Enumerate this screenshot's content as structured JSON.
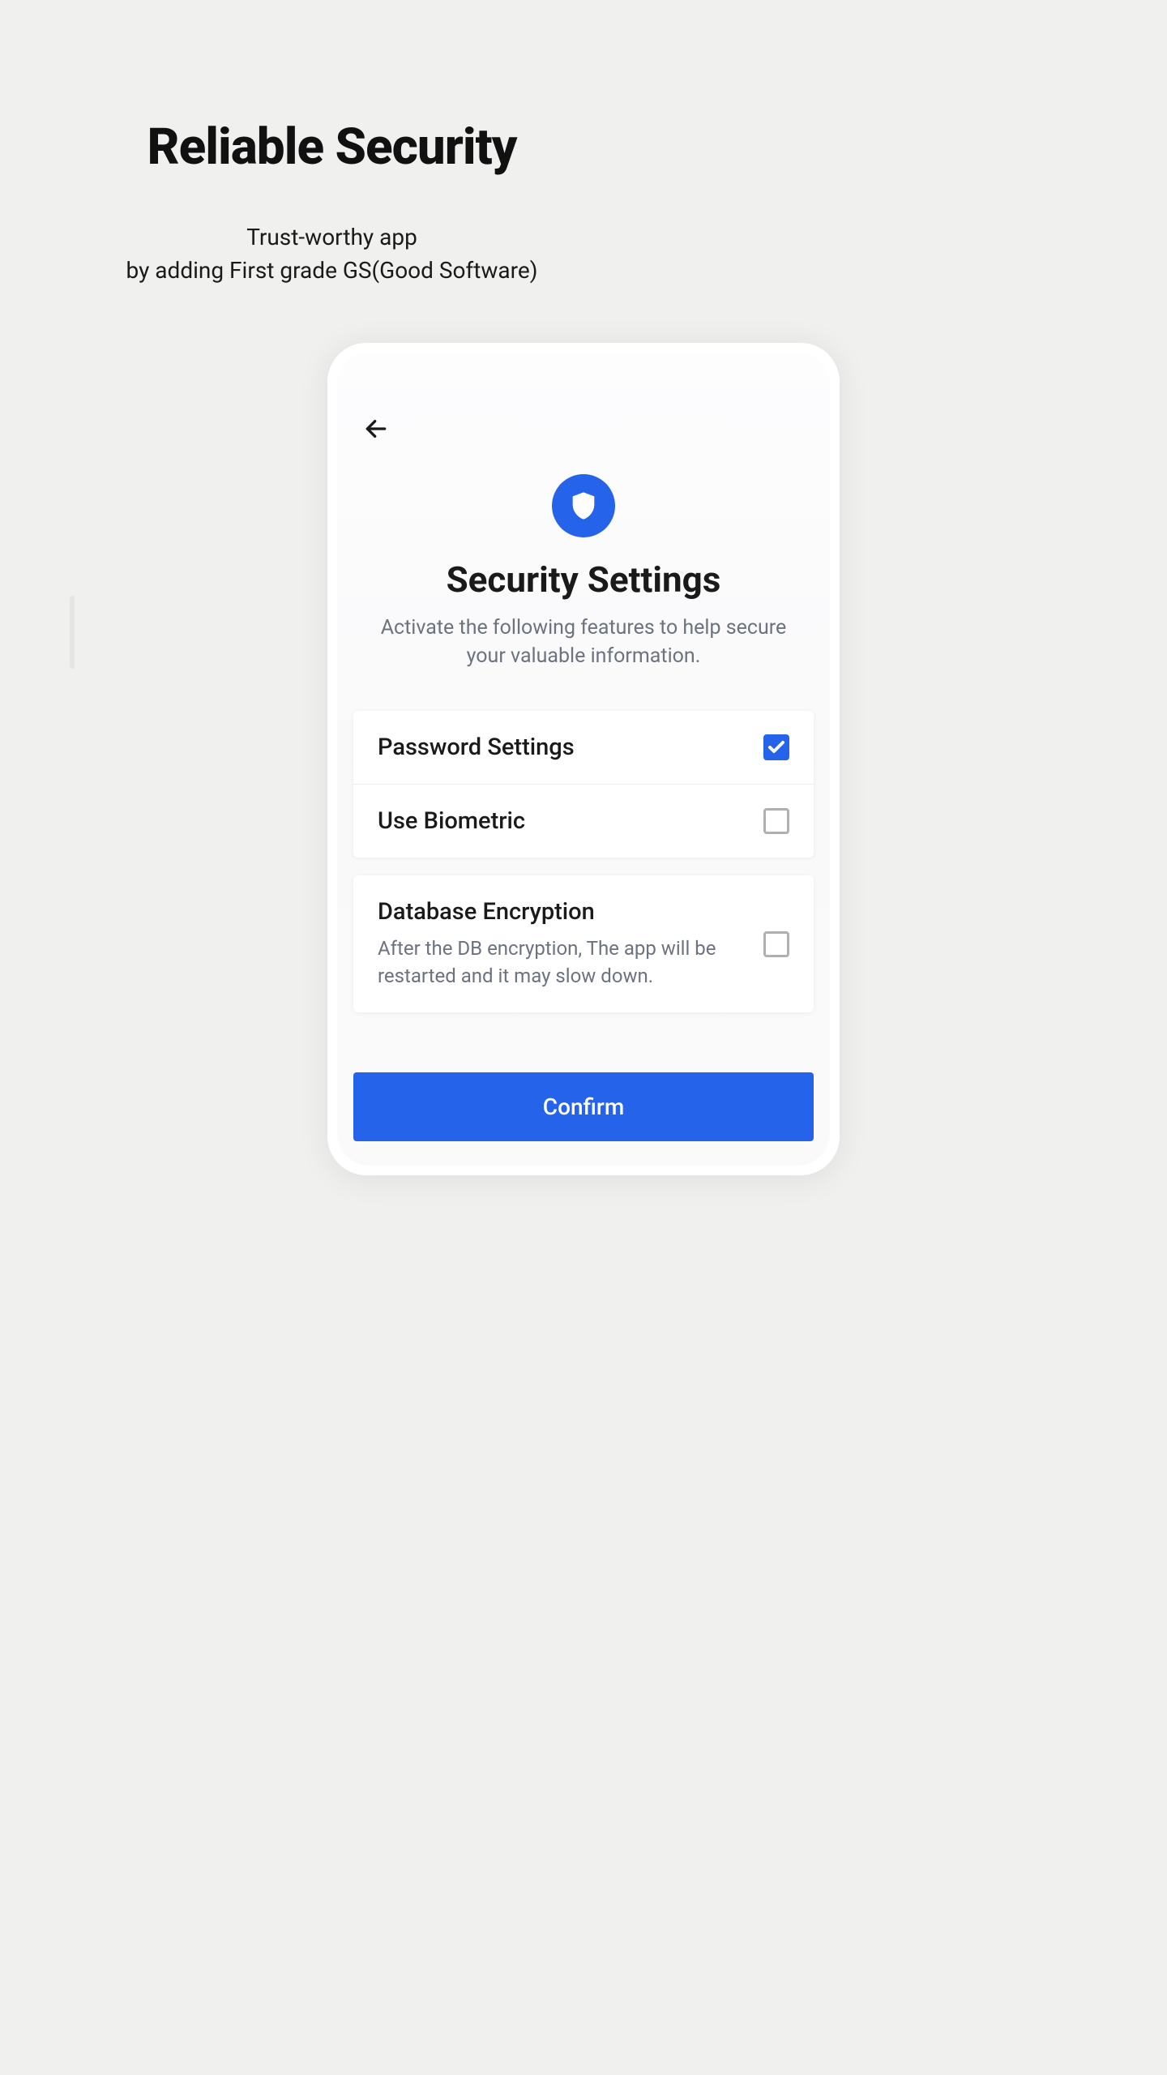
{
  "header": {
    "title": "Reliable Security",
    "subtitle_line1": "Trust-worthy app",
    "subtitle_line2": "by adding First grade GS(Good Software)"
  },
  "screen": {
    "title": "Security Settings",
    "subtitle": "Activate the following features to help secure your valuable information.",
    "confirm_label": "Confirm"
  },
  "options": {
    "password": {
      "label": "Password Settings",
      "checked": true
    },
    "biometric": {
      "label": "Use Biometric",
      "checked": false
    },
    "encryption": {
      "label": "Database Encryption",
      "desc": "After the DB encryption, The app will be restarted and it may slow down.",
      "checked": false
    }
  },
  "colors": {
    "accent": "#2563eb",
    "bg": "#f0f0ee"
  }
}
